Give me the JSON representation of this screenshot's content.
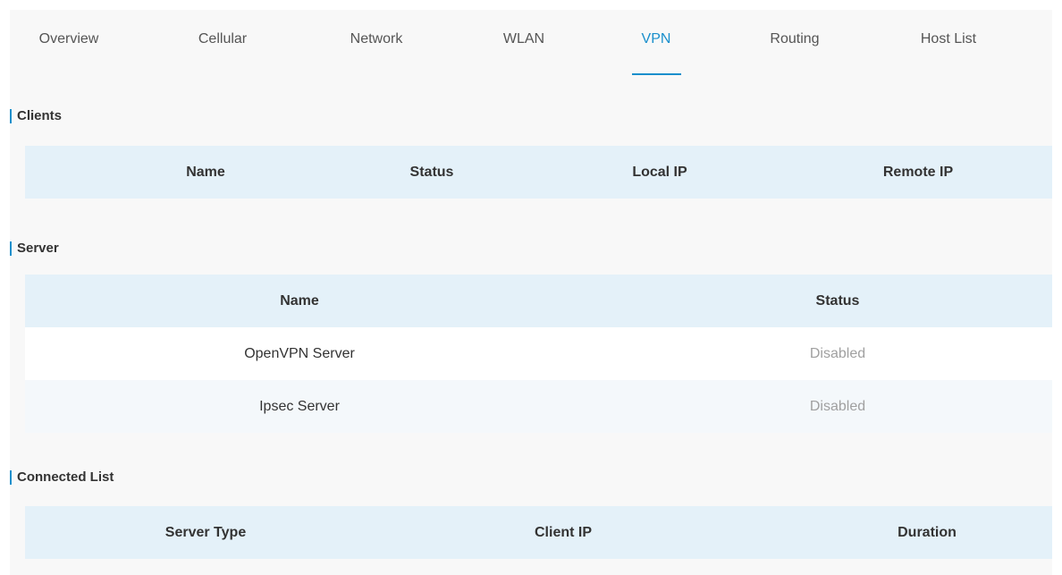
{
  "tabs": [
    "Overview",
    "Cellular",
    "Network",
    "WLAN",
    "VPN",
    "Routing",
    "Host List"
  ],
  "active_tab": "VPN",
  "clients": {
    "title": "Clients",
    "columns": [
      "Name",
      "Status",
      "Local IP",
      "Remote IP"
    ],
    "rows": []
  },
  "server": {
    "title": "Server",
    "columns": [
      "Name",
      "Status"
    ],
    "rows": [
      {
        "name": "OpenVPN Server",
        "status": "Disabled"
      },
      {
        "name": "Ipsec Server",
        "status": "Disabled"
      }
    ]
  },
  "connected": {
    "title": "Connected List",
    "columns": [
      "Server Type",
      "Client IP",
      "Duration"
    ],
    "rows": []
  },
  "colors": {
    "accent": "#1a8fcc",
    "header_bg": "#e4f1f9",
    "disabled_text": "#a0a0a0"
  }
}
